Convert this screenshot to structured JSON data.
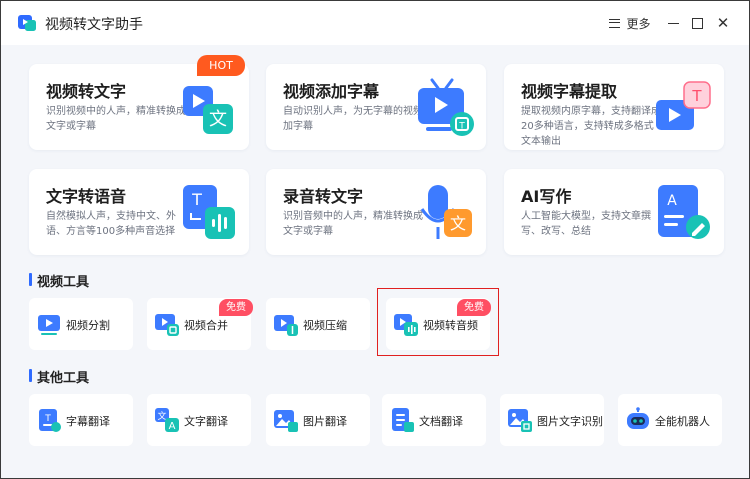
{
  "app": {
    "title": "视频转文字助手",
    "menu_label": "更多"
  },
  "feature_cards": [
    {
      "title": "视频转文字",
      "desc": "识别视频中的人声，精准转换成文字或字幕",
      "badge": "HOT"
    },
    {
      "title": "视频添加字幕",
      "desc": "自动识别人声，为无字幕的视频加字幕"
    },
    {
      "title": "视频字幕提取",
      "desc": "提取视频内原字幕，支持翻译成20多种语言，支持转成多格式文本输出"
    },
    {
      "title": "文字转语音",
      "desc": "自然模拟人声，支持中文、外语、方言等100多种声音选择"
    },
    {
      "title": "录音转文字",
      "desc": "识别音频中的人声，精准转换成文字或字幕"
    },
    {
      "title": "AI写作",
      "desc": "人工智能大模型，支持文章撰写、改写、总结"
    }
  ],
  "sections": {
    "video_tools": "视频工具",
    "other_tools": "其他工具"
  },
  "video_tools": [
    {
      "label": "视频分割"
    },
    {
      "label": "视频合并",
      "badge": "免费"
    },
    {
      "label": "视频压缩"
    },
    {
      "label": "视频转音频",
      "badge": "免费"
    }
  ],
  "other_tools": [
    {
      "label": "字幕翻译"
    },
    {
      "label": "文字翻译"
    },
    {
      "label": "图片翻译"
    },
    {
      "label": "文档翻译"
    },
    {
      "label": "图片文字识别"
    },
    {
      "label": "全能机器人"
    }
  ],
  "colors": {
    "accent": "#2f6bff",
    "hot": "#ff5a1f",
    "free": "#ff4f63",
    "highlight": "#e02020",
    "teal": "#19c2b5"
  }
}
